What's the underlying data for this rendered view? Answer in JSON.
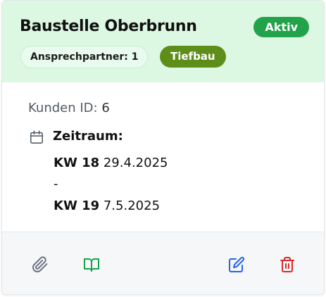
{
  "header": {
    "title": "Baustelle Oberbrunn",
    "status": "Aktiv",
    "contact_badge": "Ansprechpartner: 1",
    "type_badge": "Tiefbau"
  },
  "body": {
    "customer_label": "Kunden ID:",
    "customer_id": "6",
    "period_label": "Zeitraum:",
    "start_week": "KW 18",
    "start_date": "29.4.2025",
    "separator": "-",
    "end_week": "KW 19",
    "end_date": "7.5.2025"
  },
  "footer": {
    "icons": [
      "paperclip-icon",
      "book-open-icon",
      "edit-icon",
      "trash-icon"
    ]
  },
  "colors": {
    "header_bg": "#dcf8e3",
    "status_badge": "#22a34a",
    "type_badge": "#5e8e1a",
    "attach_icon": "#6b7280",
    "book_icon": "#16a34a",
    "edit_icon": "#2563eb",
    "delete_icon": "#dc2626"
  }
}
